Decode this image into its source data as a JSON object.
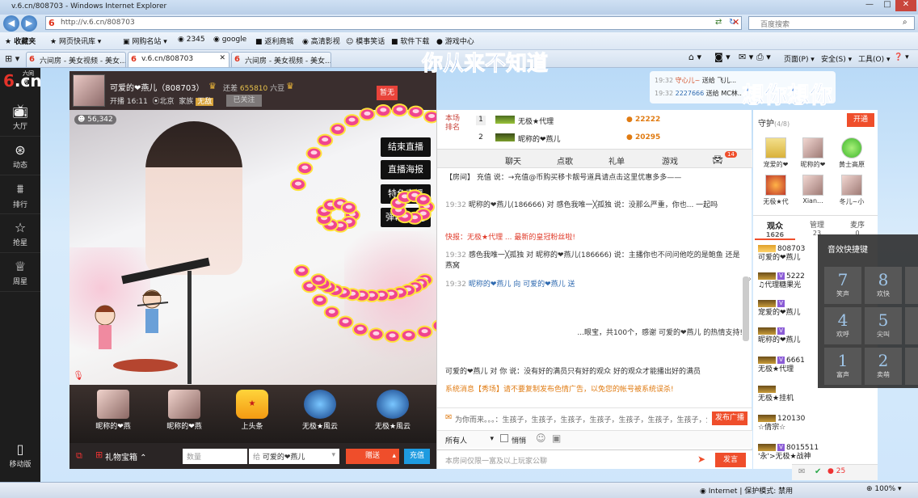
{
  "window": {
    "title": "v.6.cn/808703 - Windows Internet Explorer"
  },
  "address": {
    "url": "http://v.6.cn/808703",
    "search_placeholder": "百度搜索"
  },
  "favorites": {
    "label": "收藏夹",
    "items": [
      "网页快讯库 ▾",
      "网购名站 ▾",
      "2345",
      "google",
      "返利商城",
      "高清影视",
      "模事笑话",
      "软件下载",
      "游戏中心"
    ]
  },
  "tabs": [
    "六间房 - 美女视频 - 美女...",
    "v.6.cn/808703",
    "六间房 - 美女视频 - 美女..."
  ],
  "commands": {
    "page": "页面(P) ▾",
    "safety": "安全(S) ▾",
    "tools": "工具(O) ▾",
    "help": "❓ ▾"
  },
  "logo": {
    "brand_small": "六间房",
    "six": "6",
    "cn": ".cn"
  },
  "leftnav": [
    {
      "label": "大厅",
      "icon": "tv-icon"
    },
    {
      "label": "动态",
      "icon": "compass-icon"
    },
    {
      "label": "排行",
      "icon": "ranking-icon"
    },
    {
      "label": "抢星",
      "icon": "star-icon"
    },
    {
      "label": "周星",
      "icon": "trophy-icon"
    },
    {
      "label": "移动版",
      "icon": "mobile-icon"
    }
  ],
  "anchor": {
    "name": "可爱的❤燕儿（808703）",
    "next_level": "还差",
    "next_value": "655810",
    "next_unit": "六豆",
    "airtime": "开播 16:11",
    "location": "北京",
    "family": "家族",
    "family_badge": "无敌",
    "follow_label": "已关注",
    "status": "暂无"
  },
  "video": {
    "viewers": "56,342",
    "controls": [
      "结束直播",
      "直播海报",
      "特色直播",
      "弹幕"
    ]
  },
  "overlay": {
    "text1": "你从来不知道",
    "text2": "想你想你"
  },
  "top_notice": {
    "rows": [
      {
        "time": "19:32",
        "user": "守心儿~",
        "action": "送给 飞儿..."
      },
      {
        "time": "19:32",
        "user": "2227666",
        "action": "送给 MC林..."
      }
    ]
  },
  "gifts": [
    {
      "label": "昵称的❤燕"
    },
    {
      "label": "昵称的❤燕"
    },
    {
      "label": "上头条"
    },
    {
      "label": "无极★風云"
    },
    {
      "label": "无极★風云"
    }
  ],
  "giftbar": {
    "giftbox": "礼物宝箱 ⌃",
    "qty_placeholder": "数量",
    "target_prefix": "给",
    "target": "可爱的❤燕儿",
    "send": "赠送",
    "recharge": "充值"
  },
  "ranking": {
    "label": "本场\n排名",
    "rows": [
      {
        "rank": "1",
        "user": "无极★代理",
        "value": "22222"
      },
      {
        "rank": "2",
        "user": "昵称的❤燕儿",
        "value": "20295"
      }
    ]
  },
  "chat_tabs": [
    "聊天",
    "点歌",
    "礼单",
    "游戏"
  ],
  "chat_tab_badge": "14",
  "chat": [
    {
      "time": "",
      "text": "【房间】 充值 说：→充值@币购买移卡靓号道具请点击这里优惠多多——"
    },
    {
      "time": "19:32",
      "text": "昵称的❤燕儿(186666) 对 感色我唯一╳孤独 说：没那么严重，你也... 一起吗"
    },
    {
      "time": "",
      "text": "快报：无极★代理 ... 最新的皇冠粉丝啦!"
    },
    {
      "time": "19:32",
      "text": "感色我唯一╳孤独 对 昵称的❤燕儿(186666) 说：主播你也不问问他吃的是鲍鱼 还是燕窝"
    },
    {
      "time": "19:32",
      "text": "昵称的❤燕儿 向 可爱的❤燕儿 送"
    },
    {
      "time": "",
      "text": "...眼宝，共100个，感谢 可爱的❤燕儿 的热情支持!"
    },
    {
      "time": "",
      "text": "可爱的❤燕儿 对 你 说：没有好的满员只有好的观众 好的观众才能播出好的满员"
    },
    {
      "time": "",
      "text": "系统消息【秀场】请不要复制发布色情广告，以免您的帐号被系统误杀!"
    }
  ],
  "broadcast": {
    "placeholder": "为你而来。。。：生孩子，生孩子，生孩子，生孩子，生孩子，生孩子，生孩子，生孩子，",
    "button": "发布广播"
  },
  "chat_options": {
    "to": "所有人",
    "whisper": "悄悄"
  },
  "chat_input": {
    "placeholder": "本房间仅限一富及以上玩家公聊",
    "send": "发言"
  },
  "guard": {
    "title": "守护",
    "count": "(4/8)",
    "open": "开通",
    "members": [
      "宠爱的❤",
      "昵称的❤",
      "黄士高原",
      "无极★代",
      "Xian...",
      "冬儿~小"
    ]
  },
  "audience_tabs": [
    {
      "label": "观众",
      "count": "1626"
    },
    {
      "label": "管理",
      "count": "23"
    },
    {
      "label": "麦序",
      "count": "0"
    }
  ],
  "audience": [
    {
      "id": "808703",
      "name": "可爱的❤燕儿"
    },
    {
      "id": "5222",
      "name": "♫代理糖果光"
    },
    {
      "id": "",
      "name": "宠爱的❤燕儿"
    },
    {
      "id": "",
      "name": "昵称的❤燕儿"
    },
    {
      "id": "6661",
      "name": "无极★代理"
    },
    {
      "id": "",
      "name": "无极★挂机"
    },
    {
      "id": "120130",
      "name": "☆倩宗☆"
    },
    {
      "id": "8015511",
      "name": "'永'>无极★战神"
    }
  ],
  "bottomrow": {
    "count": "25"
  },
  "fx": {
    "title": "音效快捷键",
    "keys": [
      {
        "num": "7",
        "label": "笑声"
      },
      {
        "num": "8",
        "label": "欢快"
      },
      {
        "num": "4",
        "label": "欢呼"
      },
      {
        "num": "5",
        "label": "尖叫"
      },
      {
        "num": "1",
        "label": "富声"
      },
      {
        "num": "2",
        "label": "卖萌"
      }
    ]
  },
  "statusbar": {
    "zone": "Internet | 保护模式: 禁用",
    "zoom": "100%"
  },
  "colors": {
    "accent": "#ef4e2b",
    "blue": "#1e9be0",
    "dark": "#1d1d1d"
  }
}
